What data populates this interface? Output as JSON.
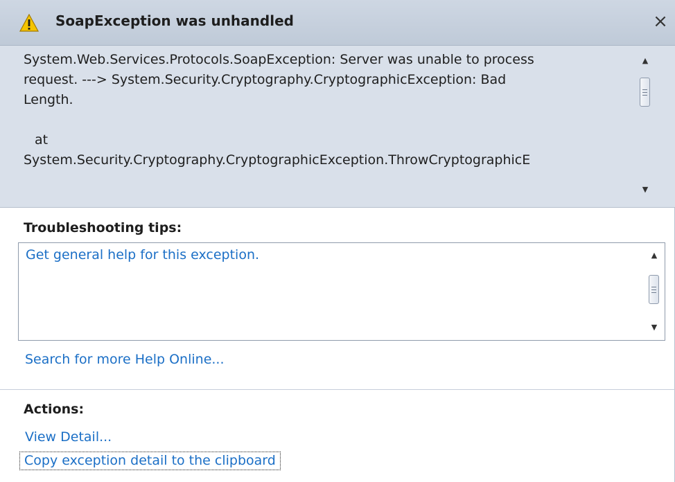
{
  "dialog": {
    "title": "SoapException was unhandled",
    "icons": {
      "title_icon": "warning-icon",
      "close": "close-icon"
    },
    "close_glyph": "×"
  },
  "message": {
    "lines": [
      "System.Web.Services.Protocols.SoapException: Server was unable to process",
      "request. ---> System.Security.Cryptography.CryptographicException: Bad",
      "Length.",
      "",
      "at",
      "System.Security.Cryptography.CryptographicException.ThrowCryptographicE"
    ]
  },
  "troubleshooting": {
    "heading": "Troubleshooting tips:",
    "tips": [
      "Get general help for this exception."
    ],
    "search_link": "Search for more Help Online..."
  },
  "actions": {
    "heading": "Actions:",
    "items": [
      "View Detail...",
      "Copy exception detail to the clipboard"
    ]
  },
  "scrollbar": {
    "up_glyph": "▲",
    "down_glyph": "▼"
  },
  "colors": {
    "title_bar": "#c8d2df",
    "message_background": "#d9e0ea",
    "link": "#1b6fc6",
    "warning_yellow": "#f5c400"
  }
}
